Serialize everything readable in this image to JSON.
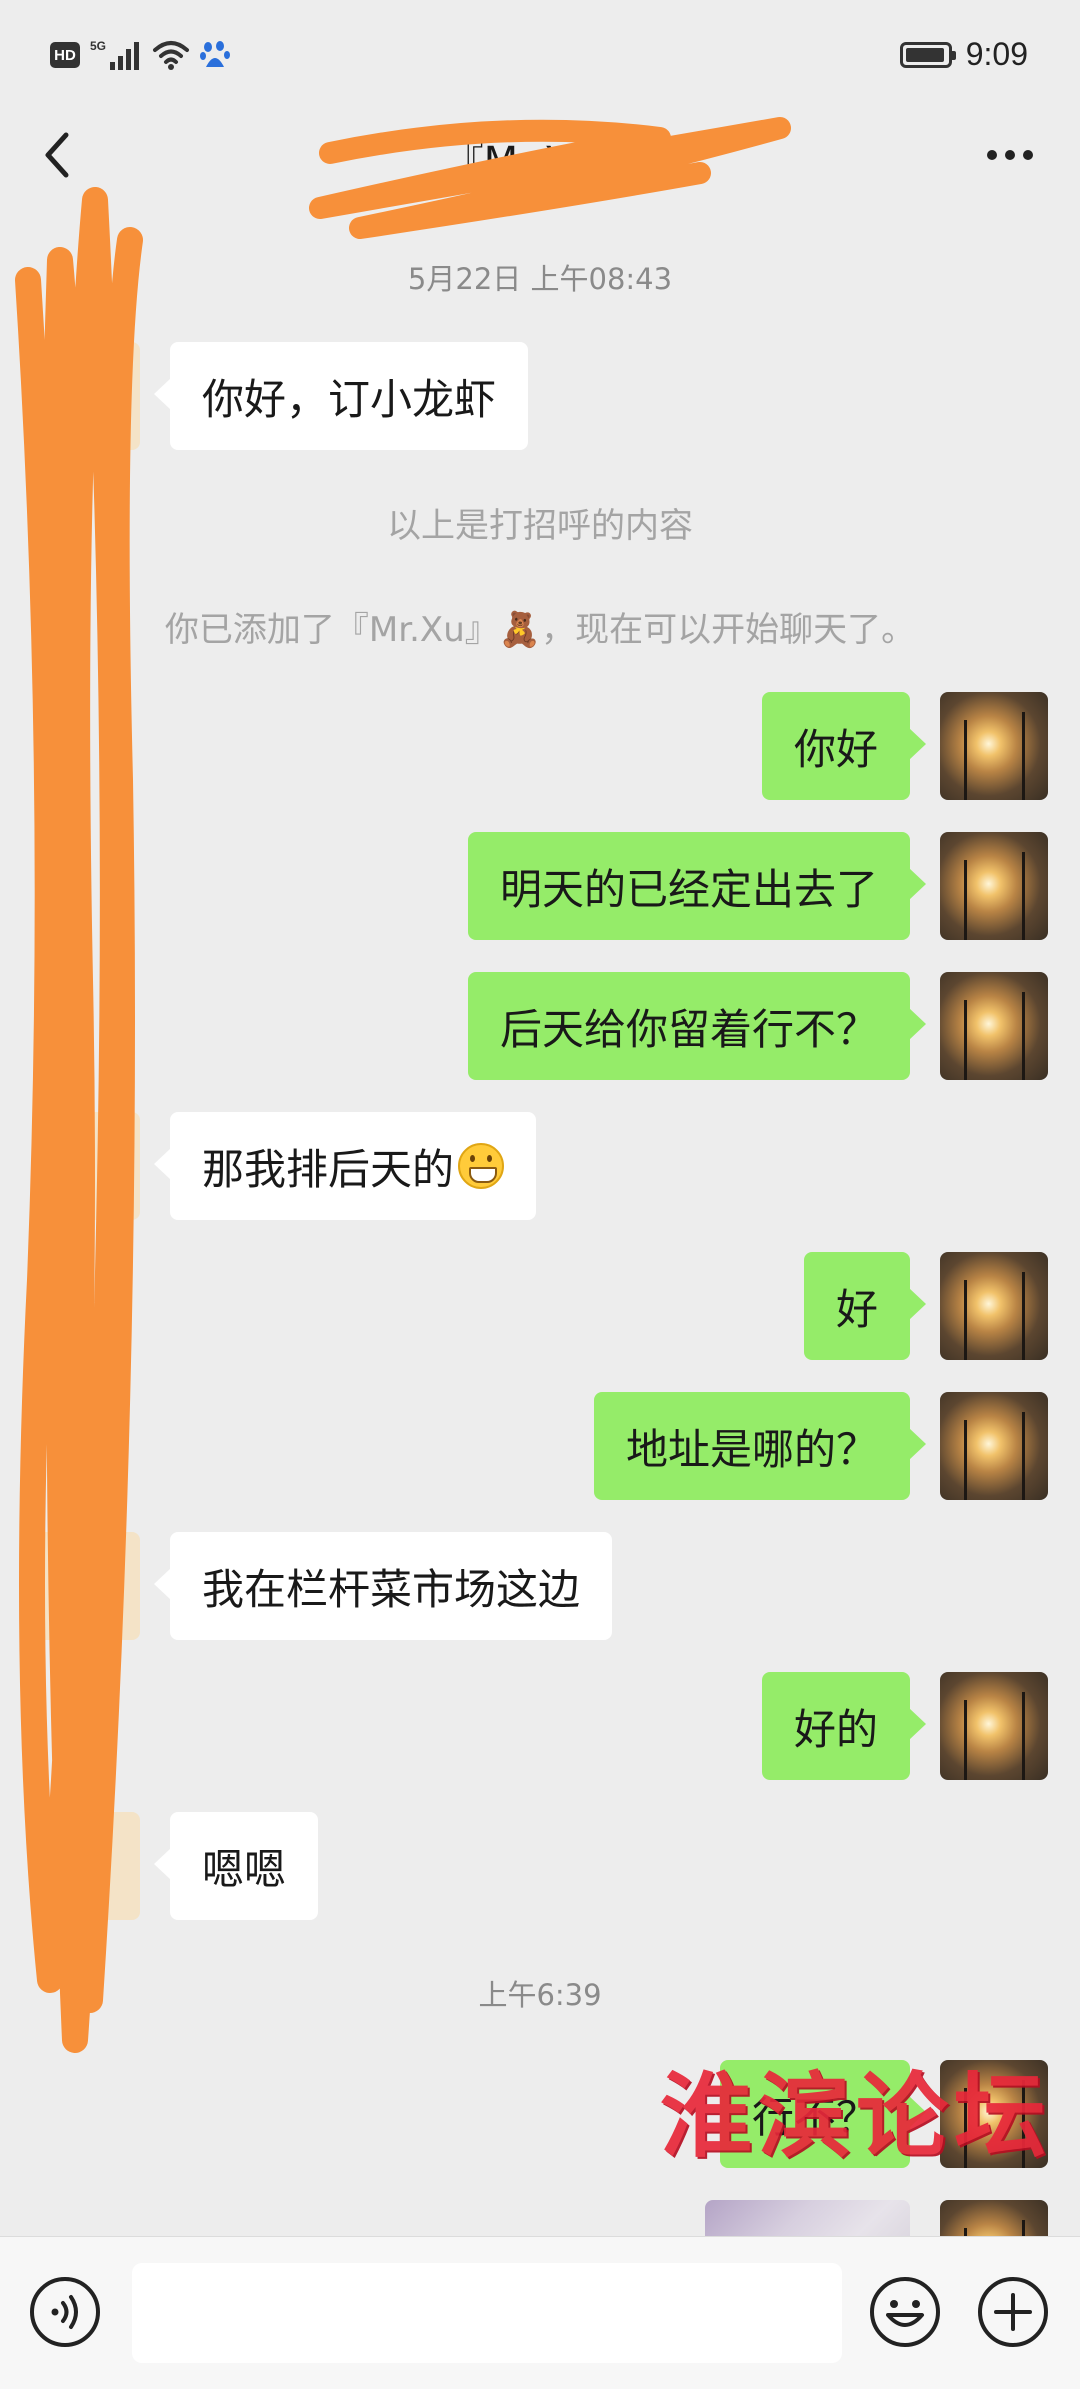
{
  "status_bar": {
    "hd": "HD",
    "network": "5G",
    "time": "9:09",
    "battery_level": 0.95,
    "icons": [
      "hd-badge",
      "5g-signal-icon",
      "wifi-icon",
      "baidu-paw-icon",
      "battery-icon"
    ]
  },
  "header": {
    "title": "『Mr.Xu』",
    "back_icon": "chevron-left-icon",
    "more_icon": "more-dots-icon"
  },
  "chat": {
    "timestamps": [
      "5月22日 上午08:43",
      "上午6:39"
    ],
    "greeting_note": "以上是打招呼的内容",
    "added_notice": "你已添加了『Mr.Xu』🧸，现在可以开始聊天了。",
    "messages": [
      {
        "from": "other",
        "text": "你好，订小龙虾"
      },
      {
        "from": "self",
        "text": "你好"
      },
      {
        "from": "self",
        "text": "明天的已经定出去了"
      },
      {
        "from": "self",
        "text": "后天给你留着行不？"
      },
      {
        "from": "other",
        "text": "那我排后天的",
        "emoji": "grinning-face-icon"
      },
      {
        "from": "self",
        "text": "好"
      },
      {
        "from": "self",
        "text": "地址是哪的？"
      },
      {
        "from": "other",
        "text": "我在栏杆菜市场这边"
      },
      {
        "from": "self",
        "text": "好的"
      },
      {
        "from": "other",
        "text": "嗯嗯"
      },
      {
        "from": "self",
        "text": "行不？"
      },
      {
        "from": "self",
        "type": "image"
      }
    ]
  },
  "watermark": "淮滨论坛",
  "input_bar": {
    "voice_icon": "voice-icon",
    "emoji_icon": "smiley-icon",
    "plus_icon": "plus-circle-icon",
    "placeholder": ""
  },
  "colors": {
    "background": "#ededed",
    "self_bubble": "#95ec69",
    "other_bubble": "#ffffff",
    "redaction": "#f7903a",
    "watermark": "#e8283a"
  }
}
